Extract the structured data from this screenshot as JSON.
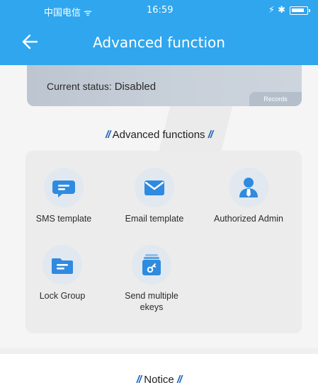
{
  "status_bar": {
    "carrier": "中国电信 ᯤ",
    "time": "16:59",
    "icons": "⚡ ✱"
  },
  "header": {
    "title": "Advanced function",
    "back_icon": "back-arrow-icon"
  },
  "status_card": {
    "label": "Current status:",
    "value": "Disabled",
    "records": "Records"
  },
  "advanced": {
    "title": "Advanced functions",
    "items": [
      {
        "label": "SMS template",
        "icon": "chat-bubble-icon"
      },
      {
        "label": "Email template",
        "icon": "envelope-icon"
      },
      {
        "label": "Authorized Admin",
        "icon": "admin-person-icon"
      },
      {
        "label": "Lock Group",
        "icon": "folder-icon"
      },
      {
        "label": "Send multiple ekeys",
        "icon": "key-card-stack-icon"
      }
    ]
  },
  "notice": {
    "title": "Notice"
  },
  "colors": {
    "header": "#2fa6ee",
    "icon_blue": "#2f8be0",
    "accent_mark": "#1e63b4"
  }
}
